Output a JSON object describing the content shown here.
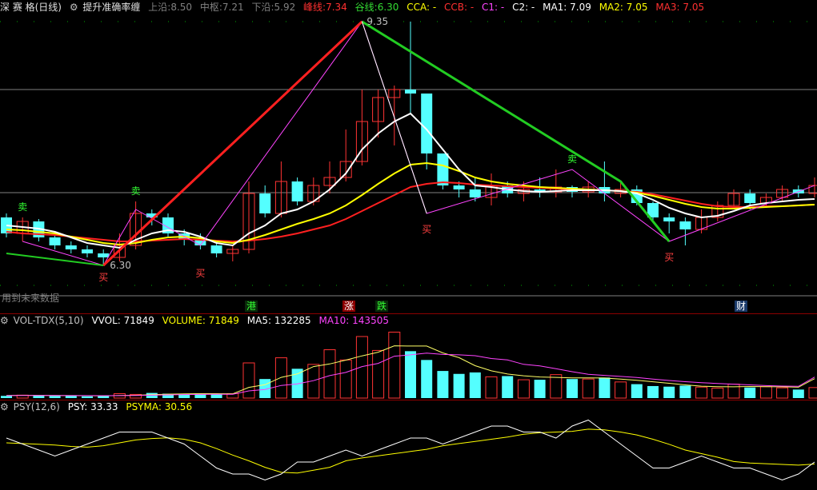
{
  "main_header": {
    "stock": "深 赛 格(日线)",
    "indicator": "提升准确率缠",
    "upper_label": "上沿:",
    "upper_value": "8.50",
    "mid_label": "中枢:",
    "mid_value": "7.21",
    "lower_label": "下沿:",
    "lower_value": "5.92",
    "peak_label": "峰线:",
    "peak_value": "7.34",
    "valley_label": "谷线:",
    "valley_value": "6.30",
    "cca": "CCA: -",
    "ccb": "CCB: -",
    "c1": "C1: -",
    "c2": "C2: -",
    "ma1": "MA1: 7.09",
    "ma2": "MA2: 7.05",
    "ma3": "MA3: 7.05"
  },
  "vol_header": {
    "name": "VOL-TDX(5,10)",
    "vvol": "VVOL: 71849",
    "volume": "VOLUME: 71849",
    "ma5": "MA5: 132285",
    "ma10": "MA10: 143505"
  },
  "psy_header": {
    "name": "PSY(12,6)",
    "psy": "PSY: 33.33",
    "psyma": "PSYMA: 30.56"
  },
  "note_text": "用到未来数据",
  "labels": {
    "high": "9.35",
    "low": "6.30",
    "sell": "卖",
    "buy": "买",
    "gang": "港",
    "zhang": "涨",
    "die": "跌",
    "cai": "财"
  },
  "colors": {
    "up": "#ff3333",
    "down": "#54ffff",
    "ma1": "#ffffff",
    "ma2": "#ffff00",
    "ma3": "#ff2020",
    "peak": "#ff2020",
    "valley": "#22cc22",
    "zigzag": "#ff44ff"
  },
  "chart_data": [
    {
      "type": "candlestick",
      "ylim": [
        5.9,
        9.4
      ],
      "levels": {
        "upper": 8.5,
        "mid": 7.21,
        "lower": 5.92
      },
      "candles": [
        [
          6.9,
          6.7,
          6.95,
          6.65
        ],
        [
          6.7,
          6.85,
          6.9,
          6.6
        ],
        [
          6.85,
          6.65,
          6.88,
          6.6
        ],
        [
          6.65,
          6.55,
          6.7,
          6.5
        ],
        [
          6.55,
          6.5,
          6.6,
          6.45
        ],
        [
          6.5,
          6.45,
          6.55,
          6.4
        ],
        [
          6.45,
          6.4,
          6.5,
          6.3
        ],
        [
          6.4,
          6.55,
          6.7,
          6.35
        ],
        [
          6.55,
          6.95,
          7.1,
          6.5
        ],
        [
          6.95,
          6.9,
          7.0,
          6.8
        ],
        [
          6.9,
          6.7,
          6.95,
          6.65
        ],
        [
          6.7,
          6.62,
          6.75,
          6.55
        ],
        [
          6.62,
          6.55,
          6.7,
          6.5
        ],
        [
          6.55,
          6.45,
          6.6,
          6.4
        ],
        [
          6.45,
          6.5,
          6.55,
          6.35
        ],
        [
          6.5,
          7.2,
          7.35,
          6.45
        ],
        [
          7.2,
          6.95,
          7.3,
          6.9
        ],
        [
          6.95,
          7.35,
          7.6,
          6.9
        ],
        [
          7.35,
          7.1,
          7.4,
          7.05
        ],
        [
          7.1,
          7.3,
          7.4,
          7.05
        ],
        [
          7.3,
          7.4,
          7.6,
          7.2
        ],
        [
          7.4,
          7.6,
          8.0,
          7.35
        ],
        [
          7.6,
          8.1,
          8.5,
          7.55
        ],
        [
          8.1,
          8.4,
          8.5,
          7.9
        ],
        [
          8.4,
          8.5,
          8.55,
          7.8
        ],
        [
          8.5,
          8.45,
          9.35,
          8.2
        ],
        [
          8.45,
          7.7,
          8.3,
          7.5
        ],
        [
          7.7,
          7.3,
          7.6,
          7.25
        ],
        [
          7.3,
          7.25,
          7.35,
          7.15
        ],
        [
          7.25,
          7.15,
          7.4,
          7.1
        ],
        [
          7.15,
          7.3,
          7.45,
          7.05
        ],
        [
          7.3,
          7.2,
          7.35,
          7.15
        ],
        [
          7.2,
          7.25,
          7.35,
          7.1
        ],
        [
          7.25,
          7.22,
          7.4,
          7.15
        ],
        [
          7.22,
          7.28,
          7.5,
          7.15
        ],
        [
          7.28,
          7.22,
          7.3,
          7.15
        ],
        [
          7.22,
          7.28,
          7.35,
          7.15
        ],
        [
          7.28,
          7.2,
          7.6,
          7.1
        ],
        [
          7.2,
          7.25,
          7.35,
          7.15
        ],
        [
          7.25,
          7.08,
          7.3,
          7.05
        ],
        [
          7.08,
          6.9,
          7.1,
          6.85
        ],
        [
          6.9,
          6.85,
          6.95,
          6.7
        ],
        [
          6.85,
          6.75,
          6.9,
          6.55
        ],
        [
          6.75,
          6.9,
          7.0,
          6.7
        ],
        [
          6.9,
          7.05,
          7.1,
          6.85
        ],
        [
          7.05,
          7.2,
          7.25,
          7.0
        ],
        [
          7.2,
          7.08,
          7.25,
          7.0
        ],
        [
          7.08,
          7.15,
          7.2,
          7.05
        ],
        [
          7.15,
          7.25,
          7.3,
          7.1
        ],
        [
          7.25,
          7.2,
          7.3,
          7.15
        ],
        [
          7.2,
          7.3,
          7.4,
          7.15
        ]
      ],
      "ma1": [
        6.8,
        6.78,
        6.76,
        6.72,
        6.65,
        6.58,
        6.55,
        6.52,
        6.62,
        6.7,
        6.74,
        6.72,
        6.66,
        6.58,
        6.55,
        6.7,
        6.8,
        6.95,
        7.0,
        7.1,
        7.25,
        7.45,
        7.75,
        7.95,
        8.1,
        8.2,
        8.0,
        7.75,
        7.5,
        7.3,
        7.28,
        7.25,
        7.23,
        7.22,
        7.23,
        7.24,
        7.24,
        7.24,
        7.23,
        7.2,
        7.12,
        7.02,
        6.95,
        6.9,
        6.92,
        6.98,
        7.05,
        7.08,
        7.1,
        7.12,
        7.13
      ],
      "ma2": [
        6.75,
        6.74,
        6.72,
        6.7,
        6.66,
        6.62,
        6.58,
        6.56,
        6.58,
        6.62,
        6.65,
        6.66,
        6.64,
        6.6,
        6.58,
        6.62,
        6.68,
        6.75,
        6.82,
        6.88,
        6.95,
        7.05,
        7.18,
        7.32,
        7.45,
        7.56,
        7.58,
        7.55,
        7.48,
        7.4,
        7.35,
        7.32,
        7.3,
        7.28,
        7.27,
        7.26,
        7.25,
        7.24,
        7.23,
        7.21,
        7.17,
        7.12,
        7.07,
        7.03,
        7.01,
        7.01,
        7.02,
        7.03,
        7.04,
        7.05,
        7.06
      ],
      "ma3": [
        6.72,
        6.7,
        6.69,
        6.68,
        6.66,
        6.64,
        6.62,
        6.6,
        6.6,
        6.61,
        6.62,
        6.63,
        6.62,
        6.61,
        6.6,
        6.61,
        6.63,
        6.66,
        6.7,
        6.75,
        6.8,
        6.88,
        6.98,
        7.08,
        7.18,
        7.28,
        7.32,
        7.34,
        7.33,
        7.31,
        7.3,
        7.29,
        7.28,
        7.27,
        7.26,
        7.25,
        7.25,
        7.24,
        7.23,
        7.22,
        7.19,
        7.15,
        7.11,
        7.07,
        7.04,
        7.03,
        7.03,
        7.04,
        7.04,
        7.05,
        7.06
      ],
      "peak_line": [
        [
          6,
          6.3
        ],
        [
          22,
          9.35
        ],
        [
          38,
          7.35
        ],
        [
          41,
          6.6
        ]
      ],
      "valley_line": [
        [
          0,
          6.45
        ],
        [
          6,
          6.3
        ]
      ],
      "zigzag": [
        [
          1,
          6.6
        ],
        [
          6,
          6.3
        ],
        [
          8,
          7.0
        ],
        [
          12,
          6.55
        ],
        [
          22,
          9.35
        ],
        [
          26,
          6.95
        ],
        [
          35,
          7.5
        ],
        [
          41,
          6.6
        ],
        [
          50,
          7.3
        ]
      ]
    },
    {
      "type": "bar",
      "name": "VOL-TDX",
      "ylim": [
        0,
        480000
      ],
      "values": [
        15000,
        20000,
        18000,
        15000,
        17000,
        12000,
        14000,
        30000,
        25000,
        35000,
        30000,
        28000,
        32000,
        26000,
        30000,
        240000,
        130000,
        275000,
        200000,
        230000,
        330000,
        260000,
        420000,
        325000,
        450000,
        320000,
        260000,
        185000,
        165000,
        175000,
        145000,
        150000,
        125000,
        125000,
        160000,
        130000,
        130000,
        140000,
        110000,
        95000,
        82000,
        78000,
        85000,
        75000,
        68000,
        95000,
        72000,
        78000,
        70000,
        58000,
        71849
      ],
      "ma5": [
        18000,
        19000,
        18500,
        17500,
        17000,
        16500,
        15500,
        17500,
        19000,
        23000,
        27000,
        29000,
        30000,
        30000,
        29000,
        73000,
        91000,
        141000,
        165000,
        215000,
        233000,
        259000,
        288000,
        313000,
        357000,
        355000,
        355000,
        308000,
        276000,
        221000,
        186000,
        164000,
        152000,
        144000,
        141000,
        138000,
        138000,
        137000,
        130000,
        121000,
        111000,
        101000,
        90000,
        81000,
        78000,
        77000,
        79000,
        78000,
        77000,
        74000,
        132285
      ],
      "ma10": [
        17000,
        17500,
        17500,
        17200,
        17000,
        16800,
        16500,
        16800,
        17500,
        19500,
        22000,
        24000,
        25000,
        25500,
        26000,
        49000,
        59000,
        86000,
        97000,
        119000,
        153000,
        175000,
        215000,
        237000,
        286000,
        295000,
        307000,
        298000,
        295000,
        289000,
        270000,
        260000,
        230000,
        220000,
        200000,
        180000,
        162000,
        155000,
        148000,
        140000,
        130000,
        120000,
        112000,
        105000,
        100000,
        95000,
        90000,
        85000,
        82000,
        80000,
        143505
      ]
    },
    {
      "type": "line",
      "name": "PSY",
      "ylim": [
        0,
        100
      ],
      "psy": [
        66.67,
        58.33,
        50.0,
        41.67,
        50.0,
        58.33,
        66.67,
        75.0,
        75.0,
        75.0,
        66.67,
        58.33,
        41.67,
        25.0,
        16.67,
        16.67,
        8.33,
        16.67,
        33.33,
        33.33,
        41.67,
        50.0,
        41.67,
        50.0,
        58.33,
        66.67,
        66.67,
        58.33,
        66.67,
        75.0,
        83.33,
        83.33,
        75.0,
        75.0,
        66.67,
        83.33,
        91.67,
        75.0,
        58.33,
        41.67,
        25.0,
        25.0,
        33.33,
        41.67,
        33.33,
        25.0,
        25.0,
        16.67,
        8.33,
        16.67,
        33.33
      ],
      "psyma": [
        60.0,
        59.0,
        58.0,
        57.0,
        55.0,
        54.0,
        56.0,
        60.0,
        64.0,
        66.0,
        67.0,
        65.0,
        60.0,
        52.0,
        43.0,
        35.0,
        26.0,
        19.0,
        18.0,
        22.0,
        26.0,
        35.0,
        39.0,
        42.0,
        45.0,
        48.0,
        51.0,
        56.0,
        59.0,
        62.0,
        65.0,
        68.0,
        72.0,
        74.0,
        75.0,
        76.0,
        79.0,
        78.0,
        75.0,
        71.0,
        65.0,
        58.0,
        50.0,
        45.0,
        40.0,
        34.0,
        32.0,
        31.0,
        30.0,
        29.0,
        30.56
      ]
    }
  ]
}
